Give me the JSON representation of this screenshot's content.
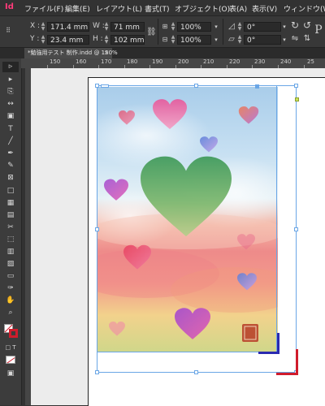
{
  "app": {
    "logo": "Id"
  },
  "menu": [
    {
      "label": "ファイル(F)"
    },
    {
      "label": "編集(E)"
    },
    {
      "label": "レイアウト(L)"
    },
    {
      "label": "書式(T)"
    },
    {
      "label": "オブジェクト(O)"
    },
    {
      "label": "表(A)"
    },
    {
      "label": "表示(V)"
    },
    {
      "label": "ウィンドウ(W)"
    }
  ],
  "control": {
    "x_label": "X :",
    "x_value": "171.4 mm",
    "y_label": "Y :",
    "y_value": "23.4 mm",
    "w_label": "W :",
    "w_value": "71 mm",
    "h_label": "H :",
    "h_value": "102 mm",
    "scale_x": "100%",
    "scale_y": "100%",
    "rotate": "0°",
    "shear": "0°",
    "overflow_char": "P"
  },
  "document": {
    "tab_title": "*勉強用テスト 制作.indd @ 150%",
    "close": "×"
  },
  "ruler": {
    "ticks": [
      "150",
      "160",
      "170",
      "180",
      "190",
      "200",
      "210",
      "220",
      "230",
      "240",
      "25"
    ]
  },
  "colors": {
    "frame": "#6aa6e6",
    "bleed_blue": "#2a2ab0",
    "bleed_red": "#d01c2c",
    "toolbox": "#3c3c3c"
  },
  "tools": [
    {
      "icon": "selection-tool",
      "glyph": "▹"
    },
    {
      "icon": "direct-selection-tool",
      "glyph": "▸"
    },
    {
      "icon": "page-tool",
      "glyph": "⎘"
    },
    {
      "icon": "gap-tool",
      "glyph": "↔"
    },
    {
      "icon": "content-collector-tool",
      "glyph": "▣"
    },
    {
      "icon": "type-tool",
      "glyph": "T"
    },
    {
      "icon": "line-tool",
      "glyph": "╱"
    },
    {
      "icon": "pen-tool",
      "glyph": "✒"
    },
    {
      "icon": "pencil-tool",
      "glyph": "✎"
    },
    {
      "icon": "rectangle-frame-tool",
      "glyph": "⊠"
    },
    {
      "icon": "rectangle-tool",
      "glyph": "□"
    },
    {
      "icon": "table-tool",
      "glyph": "▦"
    },
    {
      "icon": "grid-tool",
      "glyph": "▤"
    },
    {
      "icon": "scissors-tool",
      "glyph": "✂"
    },
    {
      "icon": "free-transform-tool",
      "glyph": "⬚"
    },
    {
      "icon": "gradient-swatch-tool",
      "glyph": "▥"
    },
    {
      "icon": "gradient-feather-tool",
      "glyph": "▨"
    },
    {
      "icon": "note-tool",
      "glyph": "▭"
    },
    {
      "icon": "eyedropper-tool",
      "glyph": "✑"
    },
    {
      "icon": "hand-tool",
      "glyph": "✋"
    },
    {
      "icon": "zoom-tool",
      "glyph": "⌕"
    }
  ]
}
